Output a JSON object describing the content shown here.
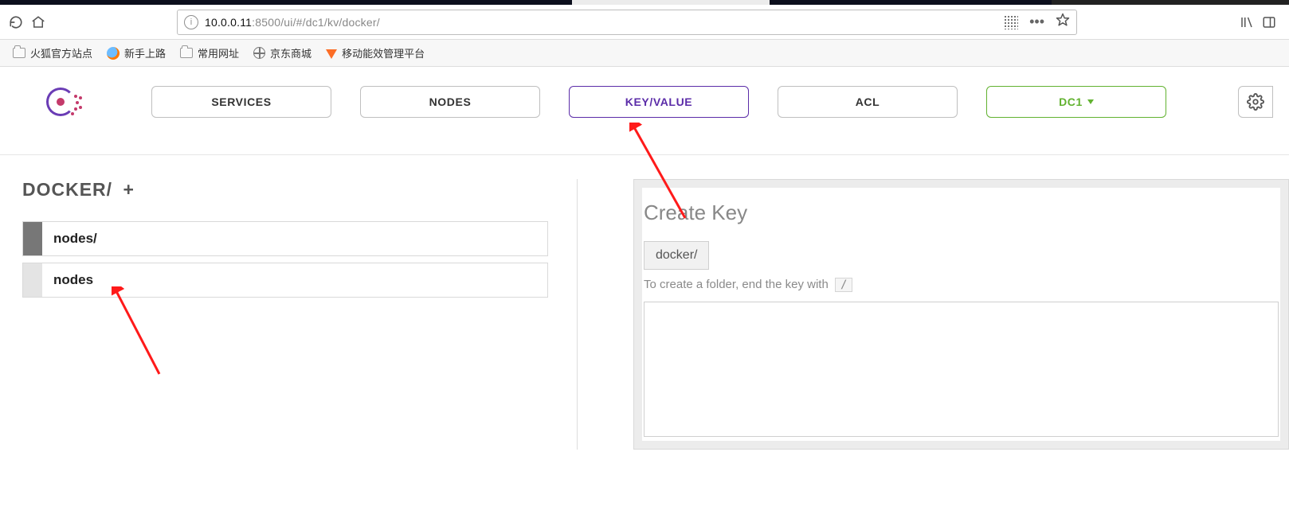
{
  "browser": {
    "url_host": "10.0.0.11",
    "url_rest": ":8500/ui/#/dc1/kv/docker/"
  },
  "bookmarks": [
    {
      "icon": "folder",
      "label": "火狐官方站点"
    },
    {
      "icon": "firefox",
      "label": "新手上路"
    },
    {
      "icon": "folder",
      "label": "常用网址"
    },
    {
      "icon": "globe",
      "label": "京东商城"
    },
    {
      "icon": "gitlab",
      "label": "移动能效管理平台"
    }
  ],
  "nav": {
    "items": [
      {
        "label": "SERVICES",
        "id": "services",
        "active": false
      },
      {
        "label": "NODES",
        "id": "nodes",
        "active": false
      },
      {
        "label": "KEY/VALUE",
        "id": "kv",
        "active": true
      },
      {
        "label": "ACL",
        "id": "acl",
        "active": false
      }
    ],
    "datacenter": "DC1"
  },
  "page": {
    "title": "DOCKER/",
    "add_symbol": "+"
  },
  "keys": [
    {
      "name": "nodes/",
      "selected": true
    },
    {
      "name": "nodes",
      "selected": false
    }
  ],
  "create": {
    "title": "Create Key",
    "prefix": "docker/",
    "hint_text": "To create a folder, end the key with",
    "hint_code": "/",
    "value": ""
  }
}
